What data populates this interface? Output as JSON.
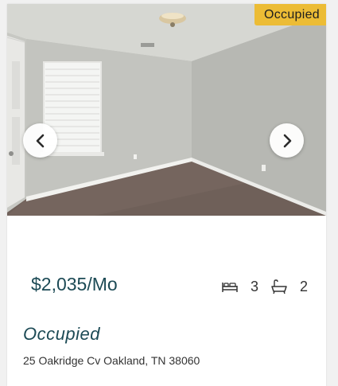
{
  "listing": {
    "badge": "Occupied",
    "price": "$2,035",
    "price_unit": "/Mo",
    "beds": "3",
    "baths": "2",
    "status": "Occupied",
    "address": "25 Oakridge Cv Oakland, TN 38060"
  },
  "icons": {
    "prev": "chevron-left-icon",
    "next": "chevron-right-icon",
    "beds": "bed-icon",
    "baths": "bathtub-icon"
  },
  "colors": {
    "badge_bg": "#ecbc35",
    "accent_text": "#1c4a55"
  }
}
